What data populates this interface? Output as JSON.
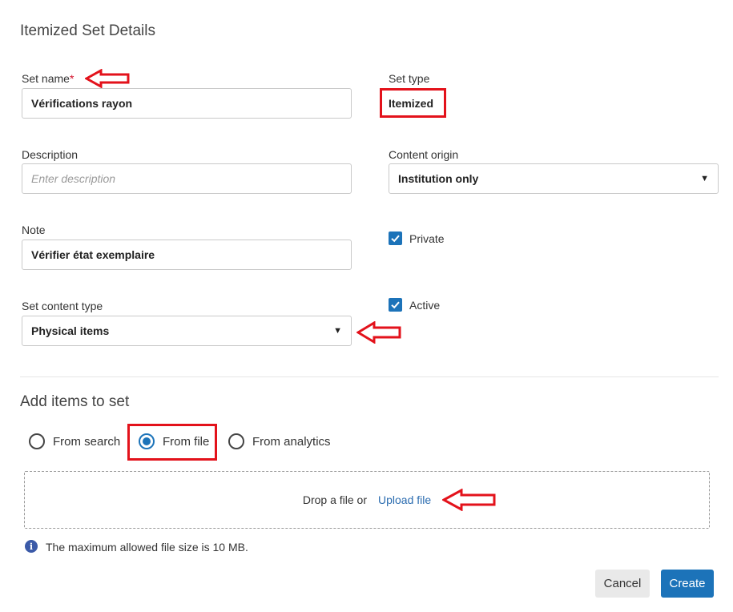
{
  "dialog": {
    "title": "Itemized Set Details"
  },
  "form": {
    "set_name": {
      "label": "Set name",
      "required_mark": "*",
      "value": "Vérifications rayon"
    },
    "set_type": {
      "label": "Set type",
      "value": "Itemized"
    },
    "description": {
      "label": "Description",
      "placeholder": "Enter description",
      "value": ""
    },
    "content_origin": {
      "label": "Content origin",
      "value": "Institution only"
    },
    "note": {
      "label": "Note",
      "value": "Vérifier état exemplaire"
    },
    "private": {
      "label": "Private",
      "checked": true
    },
    "active": {
      "label": "Active",
      "checked": true
    },
    "set_content_type": {
      "label": "Set content type",
      "value": "Physical items"
    }
  },
  "add_items": {
    "title": "Add items to set",
    "options": [
      {
        "label": "From search",
        "selected": false
      },
      {
        "label": "From file",
        "selected": true
      },
      {
        "label": "From analytics",
        "selected": false
      }
    ],
    "dropzone": {
      "text": "Drop a file or",
      "link": "Upload file"
    },
    "info": "The maximum allowed file size is 10 MB."
  },
  "buttons": {
    "cancel": "Cancel",
    "create": "Create"
  },
  "colors": {
    "primary": "#1c73b9",
    "annotation": "#e3121b",
    "link": "#2b6cb0"
  },
  "icons": {
    "caret": "caret-down-icon",
    "info": "info-icon",
    "checkbox": "checkmark-icon",
    "arrow": "annotation-arrow-left-icon"
  }
}
